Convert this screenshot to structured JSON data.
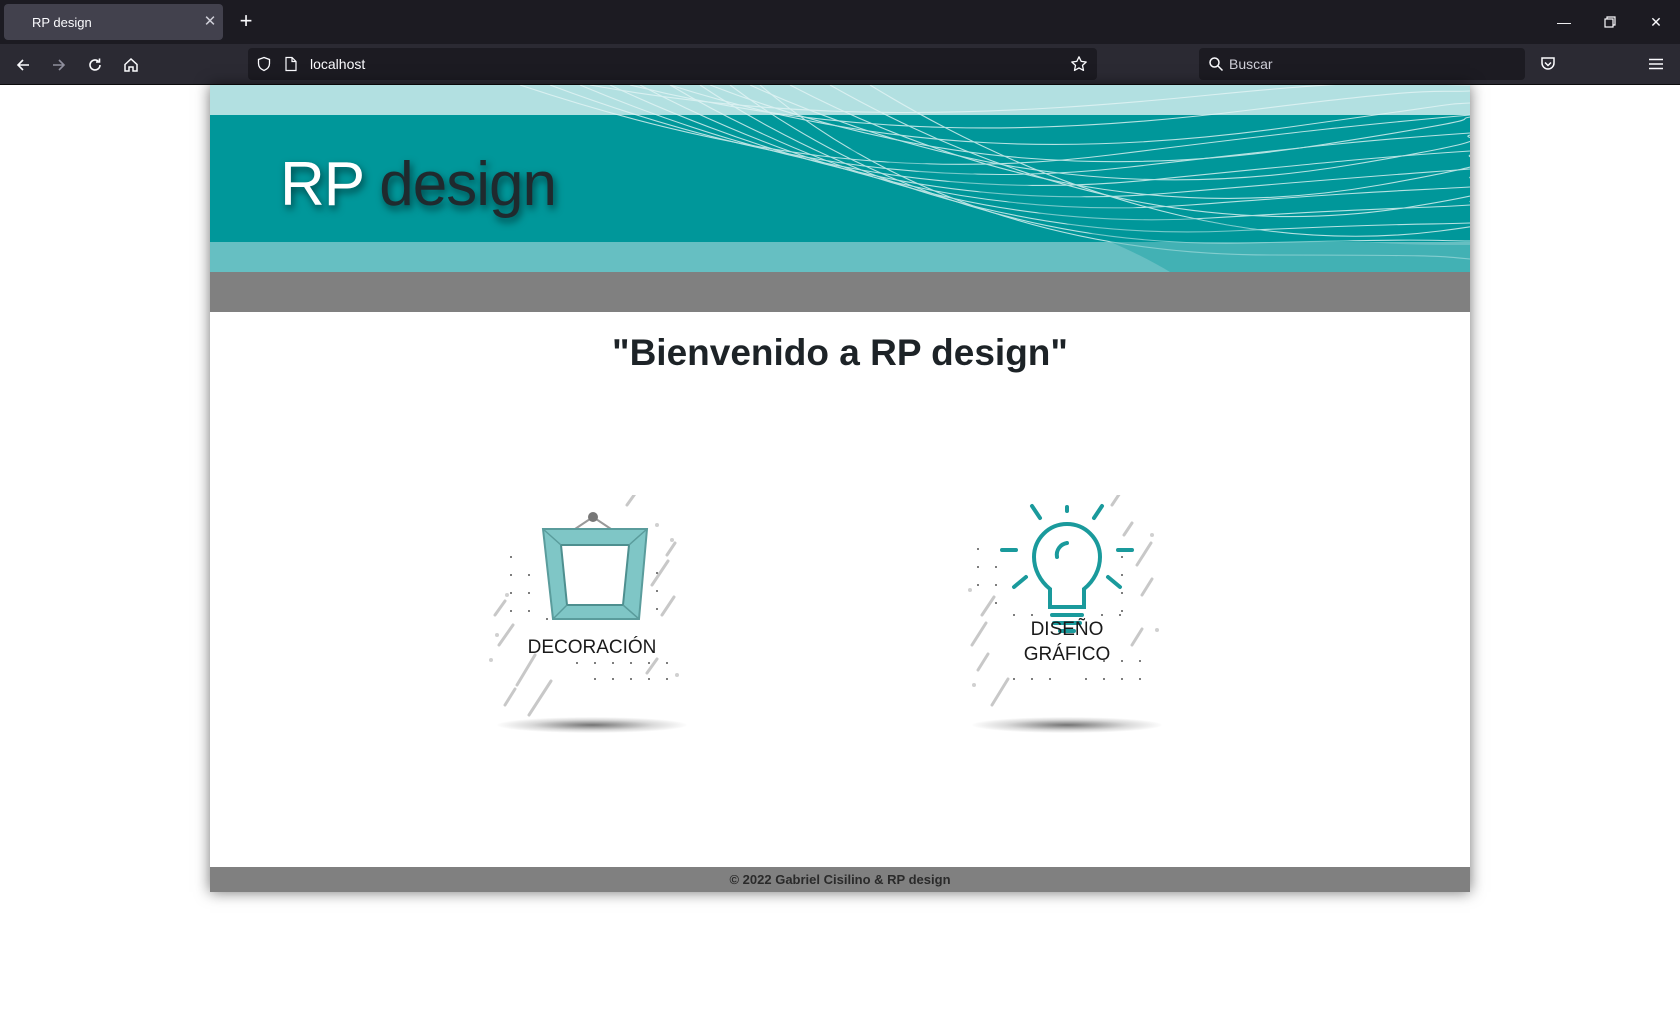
{
  "browser": {
    "tab_title": "RP design",
    "url": "localhost",
    "search_placeholder": "Buscar"
  },
  "site": {
    "logo_rp": "RP",
    "logo_design": "design",
    "welcome": "\"Bienvenido a RP design\"",
    "cards": [
      {
        "label_lines": [
          "DECORACIÓN"
        ],
        "icon": "picture-frame-icon"
      },
      {
        "label_lines": [
          "DISEÑO",
          "GRÁFICO"
        ],
        "icon": "lightbulb-icon"
      }
    ],
    "footer": "© 2022 Gabriel Cisilino & RP design"
  },
  "colors": {
    "teal": "#00979a",
    "light_teal": "#b2e0e1",
    "mid_teal": "#66bfc2",
    "gray_bar": "#808080"
  }
}
